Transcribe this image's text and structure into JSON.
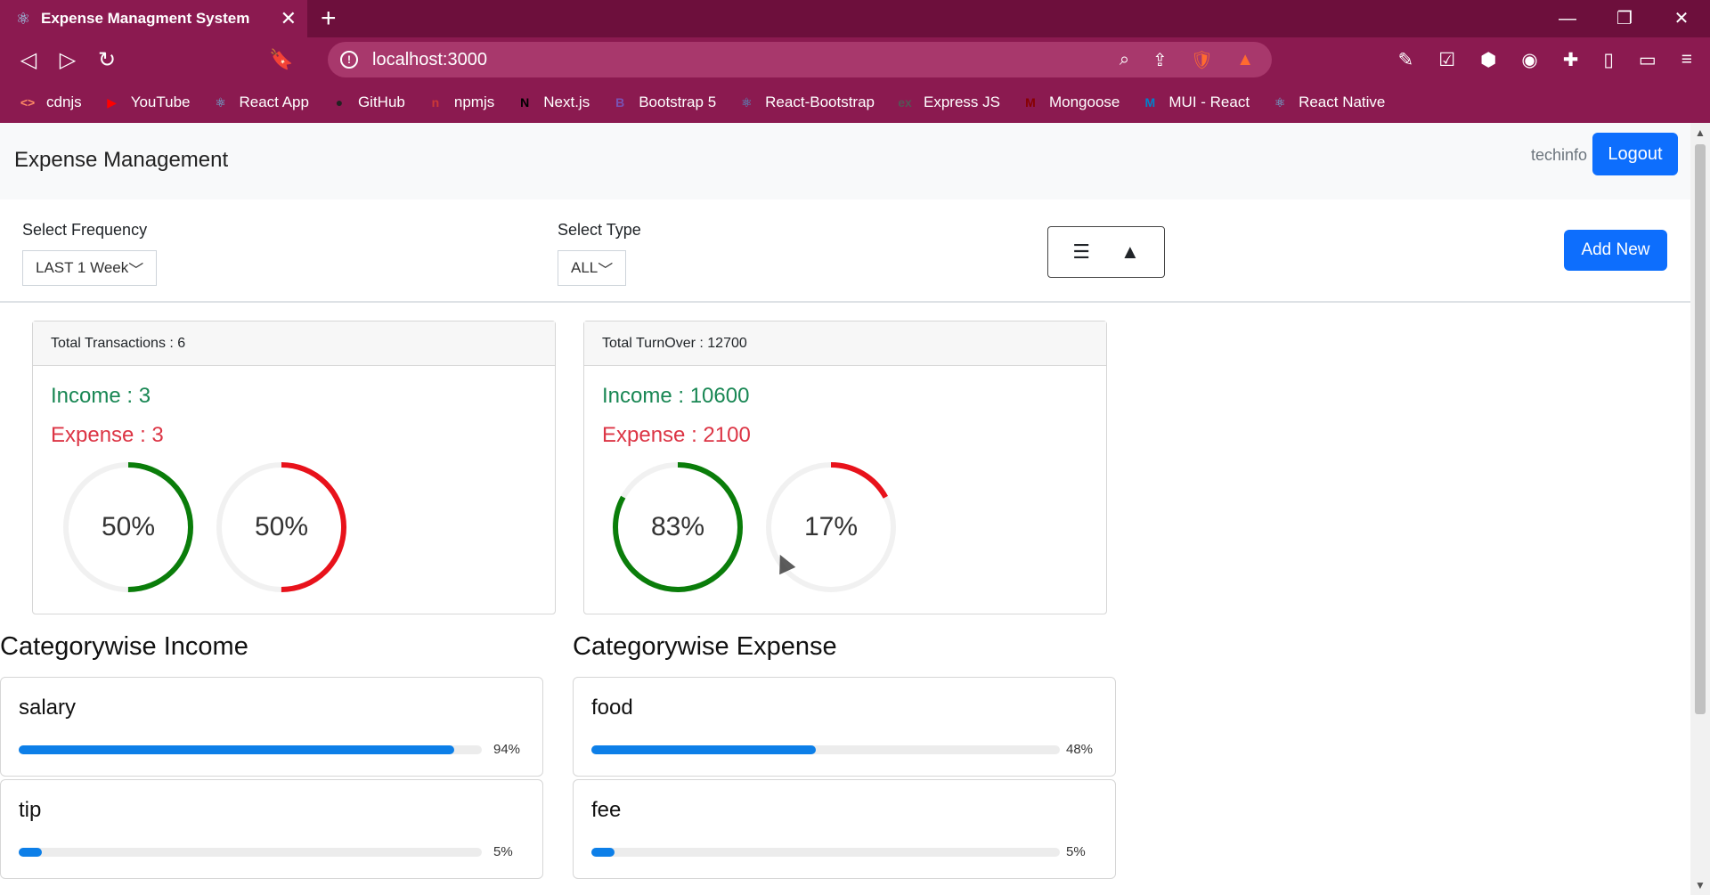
{
  "browser": {
    "tab_title": "Expense Managment System",
    "tab_close": "✕",
    "new_tab": "+",
    "window_controls": [
      "—",
      "❐",
      "✕"
    ],
    "url": "localhost:3000",
    "bookmarks": [
      {
        "label": "cdnjs",
        "icon": "<>",
        "color": "#ff8a65"
      },
      {
        "label": "YouTube",
        "icon": "▶",
        "color": "#ff0000"
      },
      {
        "label": "React App",
        "icon": "⚛",
        "color": "#61dafb"
      },
      {
        "label": "GitHub",
        "icon": "●",
        "color": "#222"
      },
      {
        "label": "npmjs",
        "icon": "n",
        "color": "#cb3837"
      },
      {
        "label": "Next.js",
        "icon": "N",
        "color": "#000"
      },
      {
        "label": "Bootstrap 5",
        "icon": "B",
        "color": "#7952b3"
      },
      {
        "label": "React-Bootstrap",
        "icon": "⚛",
        "color": "#41b4e6"
      },
      {
        "label": "Express JS",
        "icon": "ex",
        "color": "#555"
      },
      {
        "label": "Mongoose",
        "icon": "M",
        "color": "#800"
      },
      {
        "label": "MUI - React",
        "icon": "M",
        "color": "#0081cb"
      },
      {
        "label": "React Native",
        "icon": "⚛",
        "color": "#61dafb"
      }
    ]
  },
  "app": {
    "brand": "Expense Management",
    "user": "techinfo",
    "logout_label": "Logout",
    "frequency": {
      "label": "Select Frequency",
      "value": "LAST 1 Week"
    },
    "type": {
      "label": "Select Type",
      "value": "ALL"
    },
    "add_new_label": "Add New",
    "transactions_card": {
      "header": "Total Transactions : 6",
      "income": "Income : 3",
      "expense": "Expense : 3",
      "income_pct": 50,
      "expense_pct": 50,
      "income_pct_label": "50%",
      "expense_pct_label": "50%"
    },
    "turnover_card": {
      "header": "Total TurnOver : 12700",
      "income": "Income : 10600",
      "expense": "Expense : 2100",
      "income_pct": 83,
      "expense_pct": 17,
      "income_pct_label": "83%",
      "expense_pct_label": "17%"
    },
    "income_heading": "Categorywise Income",
    "expense_heading": "Categorywise Expense",
    "income_categories": [
      {
        "name": "salary",
        "pct": 94,
        "pct_label": "94%"
      },
      {
        "name": "tip",
        "pct": 5,
        "pct_label": "5%"
      }
    ],
    "expense_categories": [
      {
        "name": "food",
        "pct": 48,
        "pct_label": "48%"
      },
      {
        "name": "fee",
        "pct": 5,
        "pct_label": "5%"
      }
    ],
    "colors": {
      "income": "#198754",
      "expense": "#dc3545",
      "ring_income": "#0a7d0a",
      "ring_expense": "#e8121b",
      "bar": "#0d7fe8",
      "primary": "#0d6efd"
    }
  }
}
